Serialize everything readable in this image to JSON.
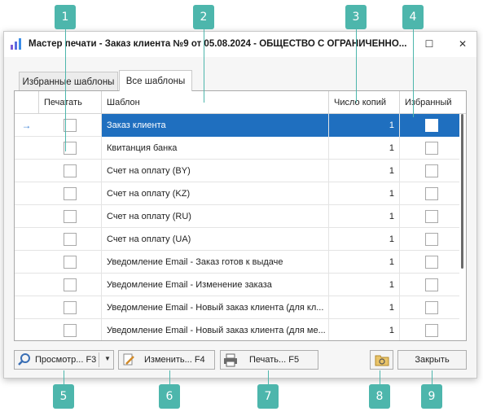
{
  "markers": [
    "1",
    "2",
    "3",
    "4",
    "5",
    "6",
    "7",
    "8",
    "9"
  ],
  "window": {
    "title": "Мастер печати - Заказ клиента №9 от 05.08.2024 - ОБЩЕСТВО С ОГРАНИЧЕННО...",
    "maximize_glyph": "☐",
    "close_glyph": "✕"
  },
  "tabs": [
    {
      "label": "Избранные шаблоны",
      "active": false
    },
    {
      "label": "Все шаблоны",
      "active": true
    }
  ],
  "grid": {
    "columns": [
      "Печатать",
      "Шаблон",
      "Число копий",
      "Избранный"
    ],
    "current_row_glyph": "→",
    "rows": [
      {
        "name": "Заказ клиента",
        "copies": "1",
        "selected": true
      },
      {
        "name": "Квитанция банка",
        "copies": "1"
      },
      {
        "name": "Счет на оплату (BY)",
        "copies": "1"
      },
      {
        "name": "Счет на оплату (KZ)",
        "copies": "1"
      },
      {
        "name": "Счет на оплату (RU)",
        "copies": "1"
      },
      {
        "name": "Счет на оплату (UA)",
        "copies": "1"
      },
      {
        "name": "Уведомление Email - Заказ готов к выдаче",
        "copies": "1"
      },
      {
        "name": "Уведомление Email - Изменение заказа",
        "copies": "1"
      },
      {
        "name": "Уведомление Email - Новый заказ клиента (для кл...",
        "copies": "1"
      },
      {
        "name": "Уведомление Email - Новый заказ клиента (для ме...",
        "copies": "1"
      }
    ]
  },
  "buttons": {
    "preview": "Просмотр... F3",
    "edit": "Изменить... F4",
    "print": "Печать... F5",
    "close": "Закрыть"
  },
  "colors": {
    "accent_marker": "#4db6ac",
    "selection": "#1f6fbf"
  }
}
